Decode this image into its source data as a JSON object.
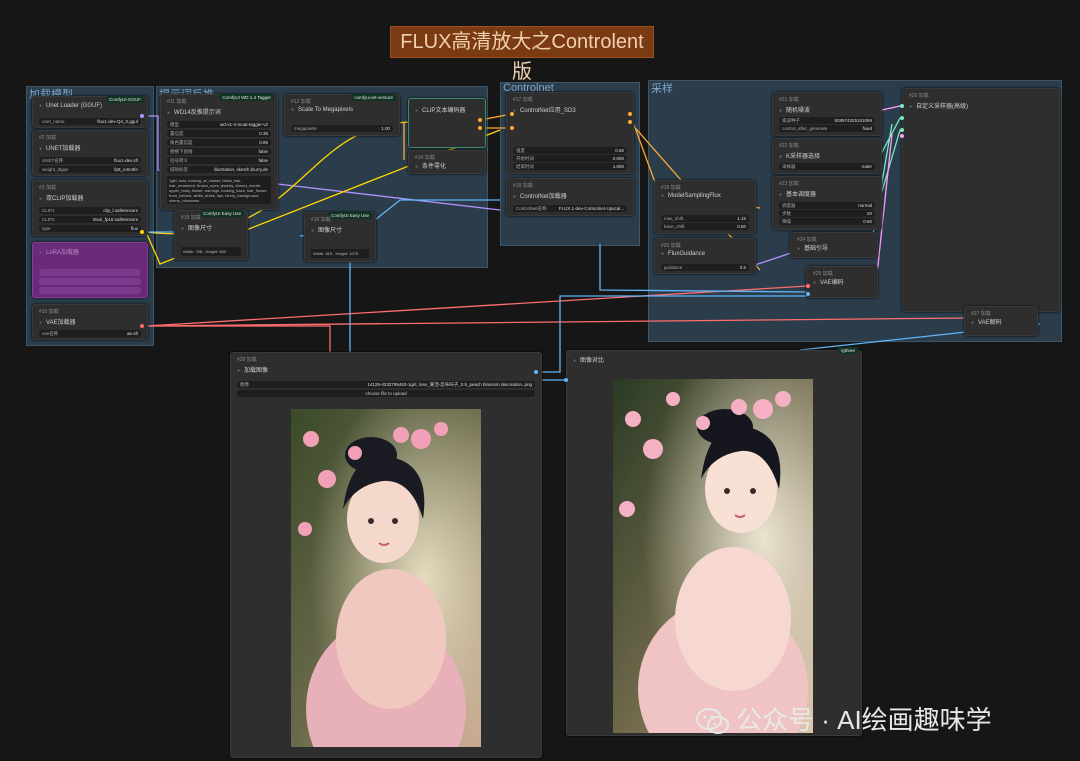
{
  "banner": "FLUX高清放大之Controlent版",
  "groups": {
    "load_model": "加载模型",
    "prompt_reverse": "提示词反推",
    "controlnet": "Controlnet",
    "sampling": "采样"
  },
  "nodes": {
    "unet_loader": {
      "id": "#1 加载",
      "title": "Unet Loader (GGUF)",
      "badge": "ComfyUI-GGUF",
      "w1_label": "unet_name",
      "w1_value": "flux1-dev-Q4_0.gguf"
    },
    "unet_load": {
      "id": "#2 加载",
      "title": "UNET加载器",
      "w1_label": "UNET名称",
      "w1_value": "flux1-dev.sft",
      "w2_label": "weight_dtype",
      "w2_value": "fp8_e4m3fn"
    },
    "dual_clip": {
      "id": "#3 加载",
      "title": "双CLIP加载器",
      "w1_label": "CLIP1",
      "w1_value": "clip_l.safetensors",
      "w2_label": "CLIP2",
      "w2_value": "t5xxl_fp16.safetensors",
      "w3_label": "type",
      "w3_value": "flux"
    },
    "lora_node": {
      "title": "LoRA加载器"
    },
    "vae_loader": {
      "id": "#10 加载",
      "title": "VAE加载器",
      "w1_label": "vae名称",
      "w1_value": "ae.sft"
    },
    "wd14": {
      "id": "#11 加载",
      "title": "WD14反推提示词",
      "badge": "ComfyUI WD 1.4 Tagger",
      "w1_label": "模型",
      "w1_value": "wd-v1-4-moat-tagger-v2",
      "w2_label": "置信度",
      "w2_value": "0.35",
      "w3_label": "角色置信度",
      "w3_value": "0.85",
      "w4_label": "替换下划线",
      "w4_value": "false",
      "w5_label": "括号转义",
      "w5_value": "false",
      "w6_label": "排除标签",
      "w6_value": "illustration, sketch,blurry,de",
      "text": "1girl, solo, looking_at_viewer, black_hair, hair_ornament, brown_eyes, jewelry, closed_mouth, upper_body, flower, earrings, looking_back, hair_flower, from_behind, white_dress, lips, blurry_background, cherry_blossoms"
    },
    "scale_mp": {
      "id": "#12 加载",
      "title": "Scale To Megapixels",
      "badge": "comfyui-art-venture",
      "w1_label": "megapixels",
      "w1_value": "1.00"
    },
    "clip_encode": {
      "id": "#13 加载",
      "title": "CLIP文本编码器"
    },
    "cond_zero": {
      "id": "#14 加载",
      "title": "条件零化"
    },
    "image_size1": {
      "id": "#15 加载",
      "title": "图像尺寸",
      "badge": "ComfyUI Easy Use",
      "text": "Width: 768 , Height: 960"
    },
    "image_size2": {
      "id": "#16 加载",
      "title": "图像尺寸",
      "badge": "ComfyUI Easy Use",
      "text": "Width: 819 , Height: 1075"
    },
    "cn_apply": {
      "id": "#17 加载",
      "title": "ControlNet应用_SD3",
      "w1_label": "强度",
      "w1_value": "0.60",
      "w2_label": "开始时间",
      "w2_value": "0.000",
      "w3_label": "结束时间",
      "w3_value": "1.000"
    },
    "cn_loader": {
      "id": "#18 加载",
      "title": "ControlNet加载器",
      "w1_label": "ControlNet名称",
      "w1_value": "FLUX.1-dev-Controlnet-Upscal..."
    },
    "model_sampling": {
      "id": "#19 加载",
      "title": "ModelSamplingFlux",
      "w1_label": "max_shift",
      "w1_value": "1.15",
      "w2_label": "base_shift",
      "w2_value": "0.50"
    },
    "flux_guidance": {
      "id": "#20 加载",
      "title": "FluxGuidance",
      "w1_label": "guidance",
      "w1_value": "3.5"
    },
    "random_noise": {
      "id": "#21 加载",
      "title": "随机噪波",
      "w1_label": "噪波种子",
      "w1_value": "928974325151069",
      "w2_label": "control_after_generate",
      "w2_value": "fixed"
    },
    "k_sampler_select": {
      "id": "#22 加载",
      "title": "K采样器选择",
      "w1_label": "采样器",
      "w1_value": "euler"
    },
    "basic_scheduler": {
      "id": "#23 加载",
      "title": "基本调度器",
      "w1_label": "调度器",
      "w1_value": "normal",
      "w2_label": "步数",
      "w2_value": "20",
      "w3_label": "降噪",
      "w3_value": "0.60"
    },
    "basic_guider": {
      "id": "#24 加载",
      "title": "基础引导"
    },
    "vae_encode": {
      "id": "#25 加载",
      "title": "VAE编码"
    },
    "custom_sampler": {
      "id": "#26 加载",
      "title": "自定义采样器(高级)"
    },
    "vae_decode": {
      "id": "#27 加载",
      "title": "VAE解码"
    },
    "load_image": {
      "id": "#28 加载",
      "title": "加载图像",
      "w1_label": "图像",
      "w1_value": "14129-4232795463-1girl, lose_果活-恋咔咔子_0.5_peach blossom decoration..png",
      "upload": "choose file to upload"
    },
    "preview_image": {
      "title": "图像对比",
      "badge": "rgthree"
    }
  },
  "watermark": "公众号 · AI绘画趣味学",
  "colors": {
    "model": "#b294ff",
    "clip": "#ffd500",
    "vae": "#ff6e6e",
    "image": "#64b5f6",
    "conditioning": "#ffa931",
    "latent": "#ff9cf9",
    "int": "#7ee8c0"
  }
}
